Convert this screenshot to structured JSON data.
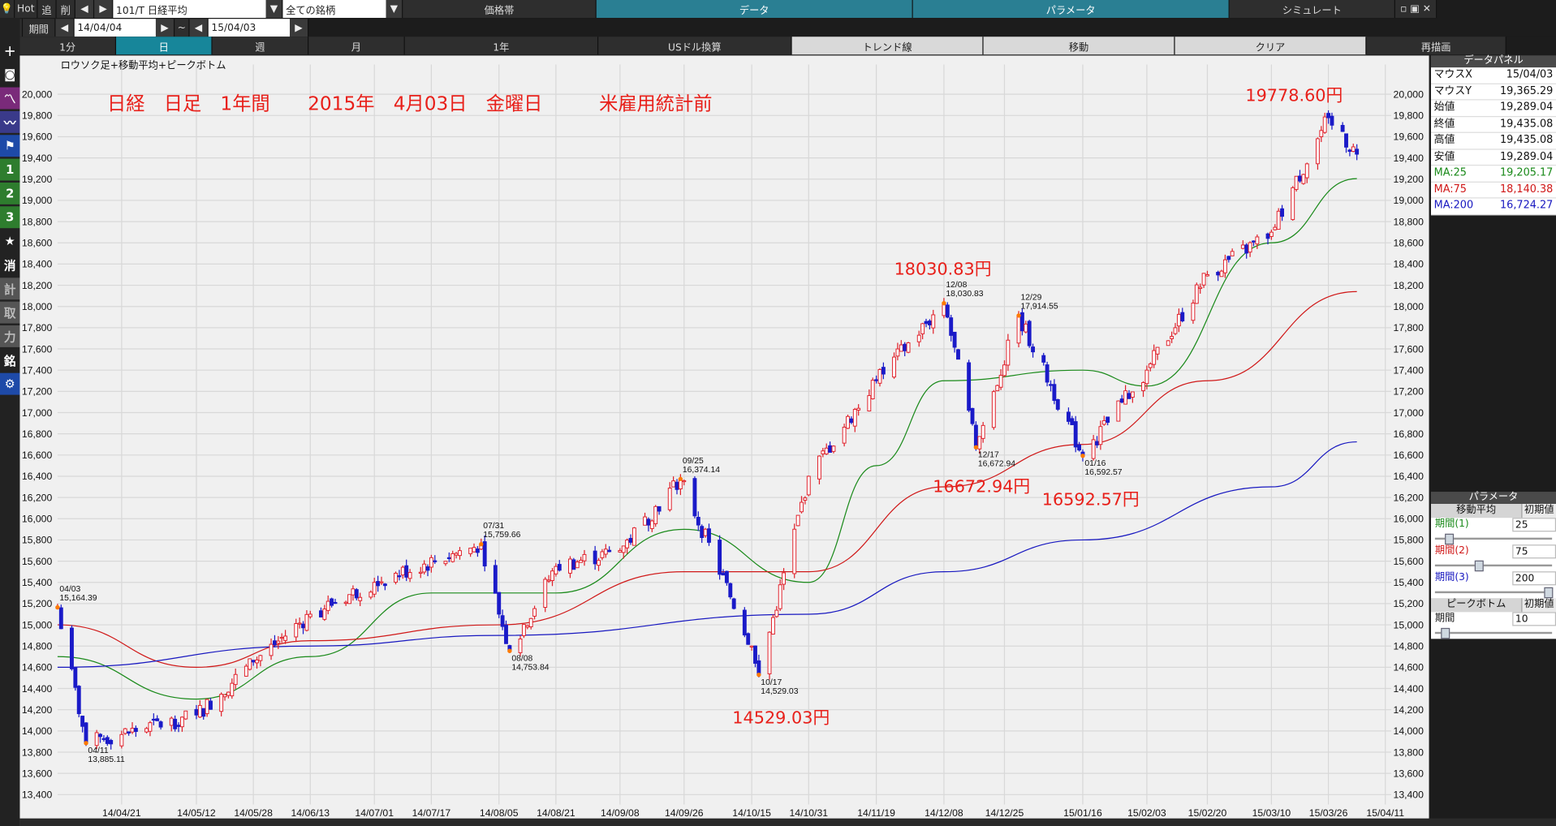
{
  "toolbar1": {
    "hot": "Hot",
    "add": "追",
    "del": "削",
    "code": "101/T 日経平均",
    "market": "全ての銘柄",
    "tab_price": "価格帯",
    "tab_data": "データ",
    "tab_param": "パラメータ",
    "tab_sim": "シミュレート"
  },
  "toolbar2": {
    "period": "期間",
    "from": "14/04/04",
    "sep": "~",
    "to": "15/04/03",
    "min1": "1分",
    "day": "日",
    "week": "週",
    "month": "月",
    "year": "1年",
    "usd": "USドル換算",
    "trend": "トレンド線",
    "move": "移動",
    "clear": "クリア",
    "redraw": "再描画"
  },
  "sidebar": {
    "n1": "1",
    "n2": "2",
    "n3": "3",
    "k1": "消",
    "k2": "計",
    "k3": "取",
    "k4": "力",
    "k5": "銘"
  },
  "chart_title": "ロウソク足+移動平均+ピークボトム",
  "headline": "日経　日足　1年間　　2015年　4月03日　金曜日　　　米雇用統計前",
  "callouts": {
    "c1": "19778.60円",
    "c2": "18030.83円",
    "c3": "16672.94円",
    "c4": "16592.57円",
    "c5": "14529.03円"
  },
  "colors": {
    "up": "#e0202a",
    "down": "#1a1ac8",
    "ma25": "#1a8a1a",
    "ma75": "#d01818",
    "ma200": "#1818c0",
    "callout": "#e8201a"
  },
  "chart_data": {
    "type": "candlestick",
    "ylim": [
      13400,
      20000
    ],
    "y_ticks": [
      "20,000",
      "19,800",
      "19,600",
      "19,400",
      "19,200",
      "19,000",
      "18,800",
      "18,600",
      "18,400",
      "18,200",
      "18,000",
      "17,800",
      "17,600",
      "17,400",
      "17,200",
      "17,000",
      "16,800",
      "16,600",
      "16,400",
      "16,200",
      "16,000",
      "15,800",
      "15,600",
      "15,400",
      "15,200",
      "15,000",
      "14,800",
      "14,600",
      "14,400",
      "14,200",
      "14,000",
      "13,800",
      "13,600",
      "13,400"
    ],
    "x_ticks": [
      "14/04/21",
      "14/05/12",
      "14/05/28",
      "14/06/13",
      "14/07/01",
      "14/07/17",
      "14/08/05",
      "14/08/21",
      "14/09/08",
      "14/09/26",
      "14/10/15",
      "14/10/31",
      "14/11/19",
      "14/12/08",
      "14/12/25",
      "15/01/16",
      "15/02/03",
      "15/02/20",
      "15/03/10",
      "15/03/26",
      "15/04/11"
    ],
    "x_dates": [
      "14/04/21",
      "14/05/12",
      "14/05/28",
      "14/06/13",
      "14/07/01",
      "14/07/17",
      "14/08/05",
      "14/08/21",
      "14/09/08",
      "14/09/26",
      "14/10/15",
      "14/10/31",
      "14/11/19",
      "14/12/08",
      "14/12/25",
      "15/01/16",
      "15/02/03",
      "15/02/20",
      "15/03/10",
      "15/03/26",
      "15/04/11"
    ],
    "anchors": [
      {
        "date": "14/04/03",
        "close": 15164.39
      },
      {
        "date": "14/04/11",
        "close": 13885.11
      },
      {
        "date": "14/05/12",
        "close": 14150
      },
      {
        "date": "14/05/28",
        "close": 14650
      },
      {
        "date": "14/06/13",
        "close": 15100
      },
      {
        "date": "14/07/01",
        "close": 15400
      },
      {
        "date": "14/07/31",
        "close": 15759.66
      },
      {
        "date": "14/08/08",
        "close": 14753.84
      },
      {
        "date": "14/08/21",
        "close": 15550
      },
      {
        "date": "14/09/08",
        "close": 15700
      },
      {
        "date": "14/09/25",
        "close": 16374.14
      },
      {
        "date": "14/10/15",
        "close": 14800
      },
      {
        "date": "14/10/17",
        "close": 14529.03
      },
      {
        "date": "14/10/31",
        "close": 16400
      },
      {
        "date": "14/11/19",
        "close": 17300
      },
      {
        "date": "14/12/08",
        "close": 18030.83
      },
      {
        "date": "14/12/17",
        "close": 16672.94
      },
      {
        "date": "14/12/29",
        "close": 17914.55
      },
      {
        "date": "15/01/16",
        "close": 16592.57
      },
      {
        "date": "15/02/03",
        "close": 17400
      },
      {
        "date": "15/02/20",
        "close": 18300
      },
      {
        "date": "15/03/10",
        "close": 18700
      },
      {
        "date": "15/03/26",
        "close": 19778.6
      },
      {
        "date": "15/04/03",
        "close": 19435.08
      }
    ],
    "ma": [
      {
        "name": "MA:25",
        "points": [
          [
            "14/04/03",
            14700
          ],
          [
            "14/05/12",
            14300
          ],
          [
            "14/06/13",
            14700
          ],
          [
            "14/07/17",
            15300
          ],
          [
            "14/08/21",
            15300
          ],
          [
            "14/09/26",
            15900
          ],
          [
            "14/10/31",
            15400
          ],
          [
            "14/11/19",
            16500
          ],
          [
            "14/12/08",
            17300
          ],
          [
            "15/01/16",
            17400
          ],
          [
            "15/02/03",
            17250
          ],
          [
            "15/03/10",
            18600
          ],
          [
            "15/04/03",
            19205.17
          ]
        ]
      },
      {
        "name": "MA:75",
        "points": [
          [
            "14/04/03",
            15000
          ],
          [
            "14/05/12",
            14600
          ],
          [
            "14/06/13",
            14850
          ],
          [
            "14/08/05",
            15000
          ],
          [
            "14/09/26",
            15500
          ],
          [
            "14/10/31",
            15500
          ],
          [
            "14/12/08",
            16300
          ],
          [
            "15/01/16",
            16700
          ],
          [
            "15/02/20",
            17300
          ],
          [
            "15/04/03",
            18140.38
          ]
        ]
      },
      {
        "name": "MA:200",
        "points": [
          [
            "14/04/03",
            14600
          ],
          [
            "14/06/13",
            14800
          ],
          [
            "14/08/05",
            14900
          ],
          [
            "14/10/31",
            15100
          ],
          [
            "14/12/08",
            15500
          ],
          [
            "15/01/16",
            15800
          ],
          [
            "15/03/10",
            16300
          ],
          [
            "15/04/03",
            16724.27
          ]
        ]
      }
    ],
    "peaks": [
      {
        "date": "14/04/03",
        "value": 15164.39,
        "label_date": "04/03",
        "label_value": "15,164.39"
      },
      {
        "date": "14/04/11",
        "value": 13885.11,
        "label_date": "04/11",
        "label_value": "13,885.11"
      },
      {
        "date": "14/07/31",
        "value": 15759.66,
        "label_date": "07/31",
        "label_value": "15,759.66"
      },
      {
        "date": "14/08/08",
        "value": 14753.84,
        "label_date": "08/08",
        "label_value": "14,753.84"
      },
      {
        "date": "14/09/25",
        "value": 16374.14,
        "label_date": "09/25",
        "label_value": "16,374.14"
      },
      {
        "date": "14/10/17",
        "value": 14529.03,
        "label_date": "10/17",
        "label_value": "14,529.03"
      },
      {
        "date": "14/12/08",
        "value": 18030.83,
        "label_date": "12/08",
        "label_value": "18,030.83"
      },
      {
        "date": "14/12/17",
        "value": 16672.94,
        "label_date": "12/17",
        "label_value": "16,672.94"
      },
      {
        "date": "14/12/29",
        "value": 17914.55,
        "label_date": "12/29",
        "label_value": "17,914.55"
      },
      {
        "date": "15/01/16",
        "value": 16592.57,
        "label_date": "01/16",
        "label_value": "16,592.57"
      }
    ]
  },
  "datapanel": {
    "title": "データパネル",
    "rows": [
      {
        "k": "マウスX",
        "v": "15/04/03"
      },
      {
        "k": "マウスY",
        "v": "19,365.29"
      },
      {
        "k": "始値",
        "v": "19,289.04"
      },
      {
        "k": "終値",
        "v": "19,435.08"
      },
      {
        "k": "高値",
        "v": "19,435.08"
      },
      {
        "k": "安値",
        "v": "19,289.04"
      },
      {
        "k": "MA:25",
        "v": "19,205.17"
      },
      {
        "k": "MA:75",
        "v": "18,140.38"
      },
      {
        "k": "MA:200",
        "v": "16,724.27"
      }
    ]
  },
  "params": {
    "title": "パラメータ",
    "ma_title": "移動平均",
    "reset": "初期値",
    "p1": "期間(1)",
    "v1": "25",
    "p2": "期間(2)",
    "v2": "75",
    "p3": "期間(3)",
    "v3": "200",
    "pb_title": "ピークボトム",
    "pb_period": "期間",
    "pb_value": "10"
  }
}
